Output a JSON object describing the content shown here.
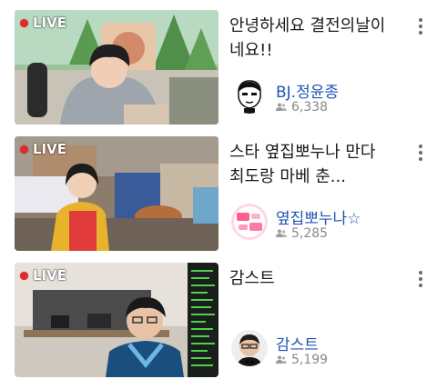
{
  "colors": {
    "live_badge": "#e8262b",
    "channel_link": "#1f55b4",
    "meta_text": "#888888"
  },
  "streams": [
    {
      "live_label": "LIVE",
      "title": "안녕하세요 결전의날이네요!!",
      "channel": "BJ.정윤종",
      "viewers": "6,338",
      "avatar_icon": "cartoon-face-avatar"
    },
    {
      "live_label": "LIVE",
      "title": "스타 옆집뽀누나   만다 최도랑  마베 춘...",
      "channel": "옆집뽀누나☆",
      "viewers": "5,285",
      "avatar_icon": "pink-logo-avatar"
    },
    {
      "live_label": "LIVE",
      "title": "감스트",
      "channel": "감스트",
      "viewers": "5,199",
      "avatar_icon": "face-portrait-avatar"
    }
  ]
}
